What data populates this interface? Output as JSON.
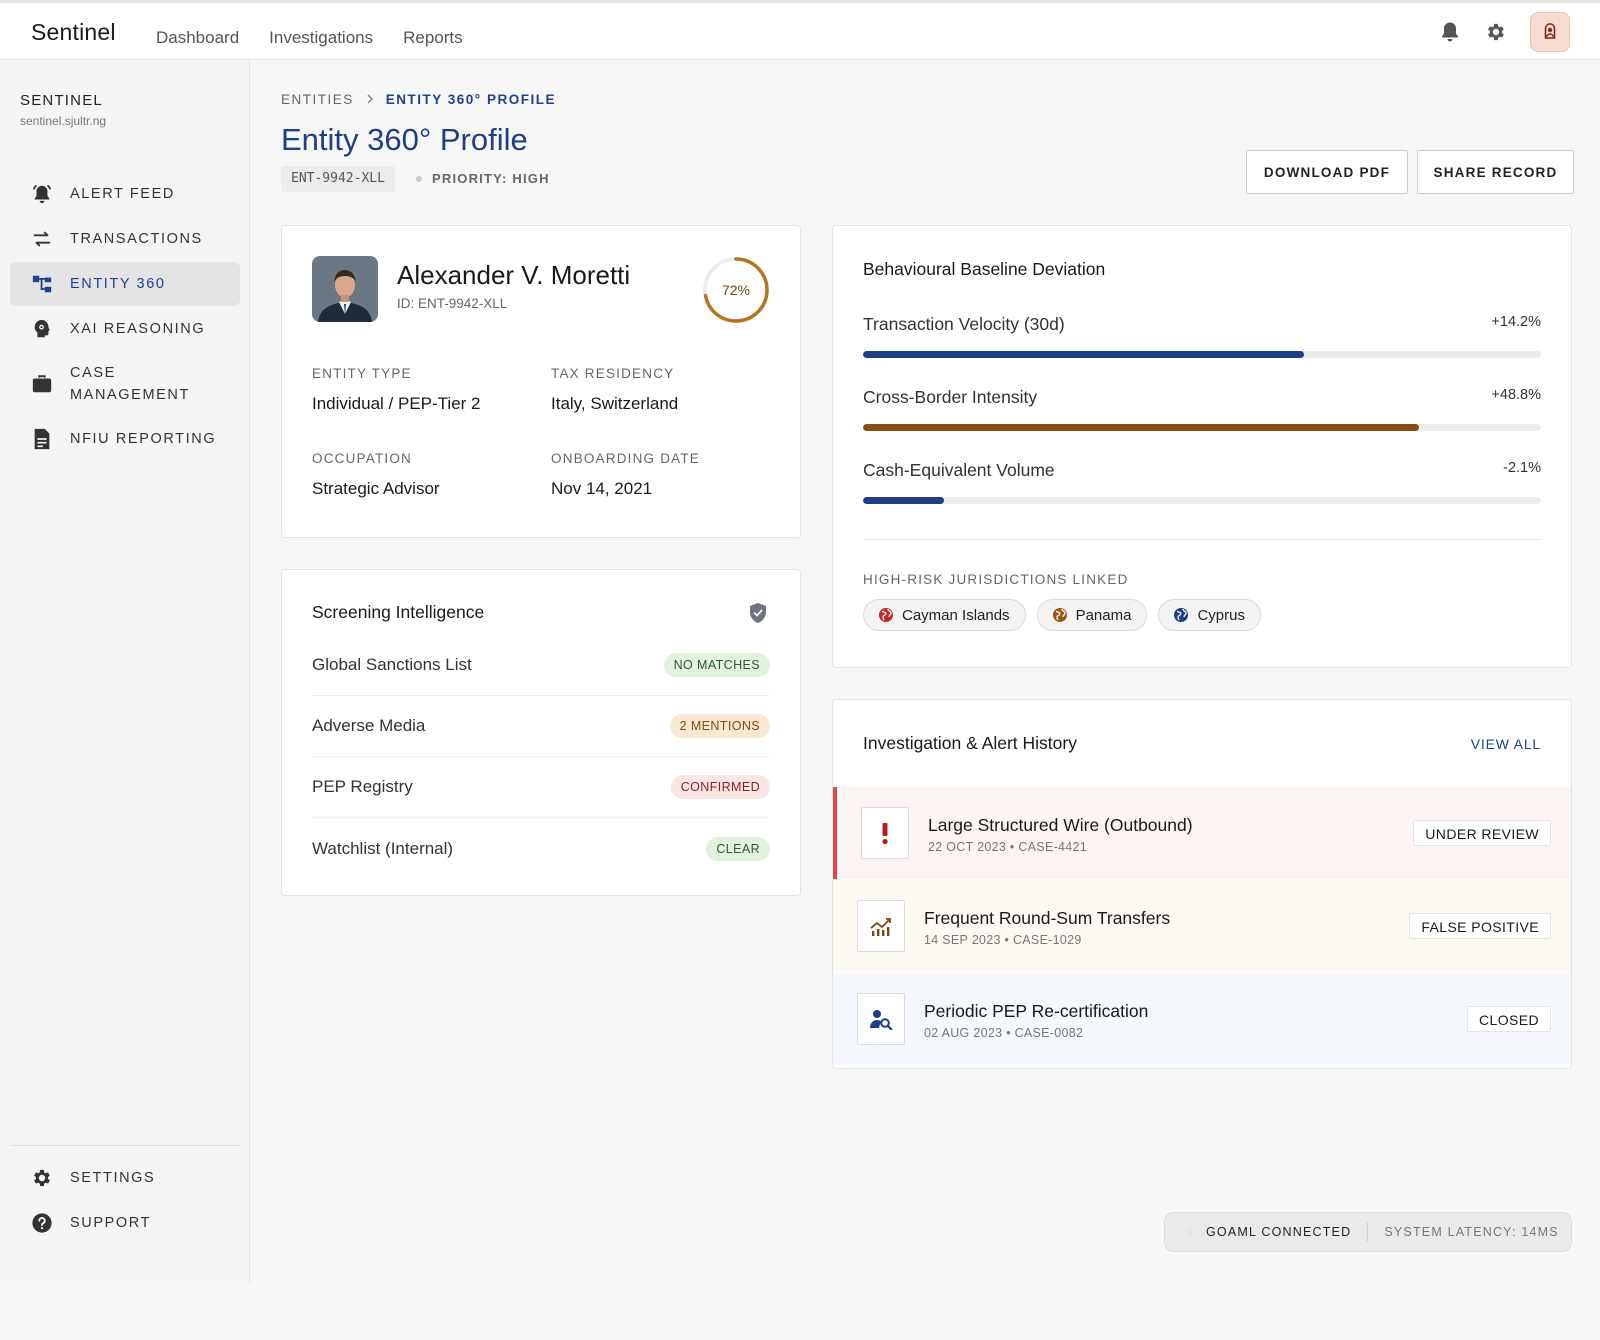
{
  "app": {
    "brand": "Sentinel",
    "top_nav": [
      "Dashboard",
      "Investigations",
      "Reports"
    ]
  },
  "sidebar": {
    "org_name": "SENTINEL",
    "org_domain": "sentinel.sjultr.ng",
    "items": [
      {
        "label": "ALERT FEED",
        "icon": "alert-bell-icon",
        "active": false
      },
      {
        "label": "TRANSACTIONS",
        "icon": "swap-arrows-icon",
        "active": false
      },
      {
        "label": "ENTITY 360",
        "icon": "hierarchy-icon",
        "active": true
      },
      {
        "label": "XAI REASONING",
        "icon": "brain-gear-icon",
        "active": false
      },
      {
        "label": "CASE MANAGEMENT",
        "label_line1": "CASE",
        "label_line2": "MANAGEMENT",
        "icon": "briefcase-icon",
        "active": false
      },
      {
        "label": "NFIU REPORTING",
        "icon": "document-icon",
        "active": false
      }
    ],
    "bottom": [
      {
        "label": "SETTINGS",
        "icon": "gear-icon"
      },
      {
        "label": "SUPPORT",
        "icon": "help-icon"
      }
    ]
  },
  "header": {
    "breadcrumb_parent": "ENTITIES",
    "breadcrumb_current": "ENTITY 360° PROFILE",
    "title": "Entity 360° Profile",
    "entity_code": "ENT-9942-XLL",
    "priority": "PRIORITY: HIGH",
    "download_label": "DOWNLOAD PDF",
    "share_label": "SHARE RECORD"
  },
  "profile": {
    "name": "Alexander V. Moretti",
    "id_line": "ID: ENT-9942-XLL",
    "risk_score_label": "72%",
    "risk_score": 0.72,
    "fields": [
      {
        "label": "ENTITY TYPE",
        "value": "Individual / PEP-Tier 2"
      },
      {
        "label": "TAX RESIDENCY",
        "value": "Italy, Switzerland"
      },
      {
        "label": "OCCUPATION",
        "value": "Strategic Advisor"
      },
      {
        "label": "ONBOARDING DATE",
        "value": "Nov 14, 2021"
      }
    ]
  },
  "screening": {
    "title": "Screening Intelligence",
    "rows": [
      {
        "label": "Global Sanctions List",
        "badge": "NO MATCHES",
        "tone": "green"
      },
      {
        "label": "Adverse Media",
        "badge": "2 MENTIONS",
        "tone": "amber"
      },
      {
        "label": "PEP Registry",
        "badge": "CONFIRMED",
        "tone": "red"
      },
      {
        "label": "Watchlist (Internal)",
        "badge": "CLEAR",
        "tone": "green"
      }
    ]
  },
  "deviation": {
    "title": "Behavioural Baseline Deviation",
    "metrics": [
      {
        "label": "Transaction Velocity (30d)",
        "value": "+14.2%",
        "level": 0.65,
        "color": "#1f3e86"
      },
      {
        "label": "Cross-Border Intensity",
        "value": "+48.8%",
        "level": 0.82,
        "color": "#8a4e10"
      },
      {
        "label": "Cash-Equivalent Volume",
        "value": "-2.1%",
        "level": 0.12,
        "color": "#1f3e86"
      }
    ],
    "jurisdictions_label": "HIGH-RISK JURISDICTIONS LINKED",
    "jurisdictions": [
      {
        "name": "Cayman Islands",
        "color": "#c62828"
      },
      {
        "name": "Panama",
        "color": "#9a5614"
      },
      {
        "name": "Cyprus",
        "color": "#1f3e86"
      }
    ]
  },
  "history": {
    "title": "Investigation & Alert History",
    "view_all": "VIEW ALL",
    "items": [
      {
        "title": "Large Structured Wire (Outbound)",
        "sub": "22 OCT 2023 • CASE-4421",
        "status": "UNDER REVIEW",
        "icon": "exclamation-icon",
        "bg": "#fcf5f3",
        "accent": "#d94a4a"
      },
      {
        "title": "Frequent Round-Sum Transfers",
        "sub": "14 SEP 2023 • CASE-1029",
        "status": "FALSE POSITIVE",
        "icon": "trend-chart-icon",
        "bg": "#fdfaf4",
        "accent": ""
      },
      {
        "title": "Periodic PEP Re-certification",
        "sub": "02 AUG 2023 • CASE-0082",
        "status": "CLOSED",
        "icon": "user-search-icon",
        "bg": "#f5f9fd",
        "accent": ""
      }
    ]
  },
  "footer": {
    "connection": "GOAML CONNECTED",
    "latency": "SYSTEM LATENCY: 14MS"
  }
}
